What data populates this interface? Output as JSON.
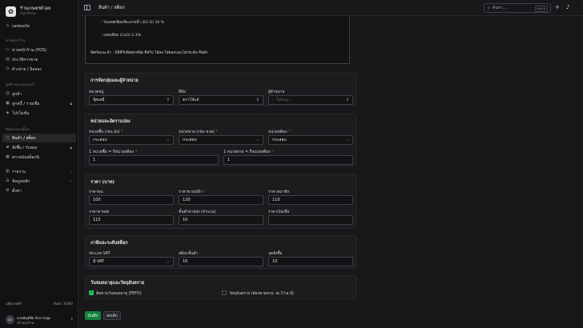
{
  "brand": {
    "name": "ร้านเกษตรตัวอย",
    "sub": "AgriShop"
  },
  "nav": {
    "dashboard": "แดชบอร์ด",
    "sec_sales": "ขายหน้าร้าน",
    "pos": "ขายหน้าร้าน (POS)",
    "history": "ประวัติการขาย",
    "ar": "ค้างจ่าย / บิลจอง",
    "sec_customers": "ลูกค้าและแมมเบอร์",
    "customers": "ลูกค้า",
    "debtors": "ลูกหนี้ / รายเชื่อ",
    "promo": "โปรโมชั่น",
    "sec_stock": "สินค้าและสต็อก",
    "products": "สินค้า / สต็อก",
    "purchase": "สั่งซื้อ / รับของ",
    "count": "ตรวจนับสต็อกนิ",
    "reports": "รายงาน",
    "data": "ข้อมูลหลัก",
    "settings": "ตั้งค่า"
  },
  "sidebar_footer": {
    "plan": "แพ็กเกจฟรี",
    "usage": "สินค้า 3/300",
    "user_initials": "นร",
    "user_name": "นายนันท์ชัย รักการปลูก",
    "user_role": "เจ้าของร้าน"
  },
  "topbar": {
    "breadcrumb": "สินค้า / สต็อก",
    "search_placeholder": "ค้นหา...",
    "shortcut": "Ctrl K"
  },
  "desc": {
    "line1": ": โพแทสเซียมที่ละลายน้ำ (K2 O) 16 %",
    "line2": ": แคลเซียม (CaO) 2.3%",
    "line3": "พิศกัดแนะนำ     : มีสีที่รับพิษทุกชนิด พืชใบ ไม้ผล ไม้ดอกและไม้ประดับ พืชผัก"
  },
  "grouping": {
    "title": "การจัดกลุ่มและผู้จำหน่าย",
    "category_label": "หมวดหมู่",
    "category_value": "ปุ๋ยเคมี",
    "brand_label": "ยี่ห้อ",
    "brand_value": "ตราไจ๋แจ๋",
    "supplier_label": "ผู้จำหน่าย",
    "supplier_value": "-- ไม่ระบุ --"
  },
  "units": {
    "title": "หน่วยและอัตราแปลง",
    "buy_label": "หน่วยซื้อ (เช่น ลัง)",
    "buy_value": "กระสอบ",
    "sell_label": "หน่วยขาย (เช่น ขวด)",
    "sell_value": "กระสอบ",
    "stock_label": "หน่วยสต็อก",
    "stock_value": "กระสอบ",
    "conv_buy_label": "1 หน่วยซื้อ = กี่หน่วยสต็อก",
    "conv_buy_value": "1",
    "conv_sell_label": "1 หน่วยขาย = กี่หน่วยสต็อก",
    "conv_sell_value": "1"
  },
  "pricing": {
    "title": "ราคา (บาท)",
    "cost_label": "ราคาทุน",
    "cost_value": "100",
    "retail_label": "ราคาขายปลีก",
    "retail_value": "120",
    "member_label": "ราคาสมาชิก",
    "member_value": "110",
    "wholesale_label": "ราคาขายส่ง",
    "wholesale_value": "115",
    "min_wholesale_label": "ขั้นต่ำขายส่ง (จำนวน)",
    "min_wholesale_value": "10",
    "credit_label": "ราคาเงินเชื่อ",
    "credit_value": ""
  },
  "tax": {
    "title": "ภาษีและระดับสต็อก",
    "vat_label": "ประเภท VAT",
    "vat_value": "มี VAT",
    "min_label": "สต็อกขั้นต่ำ",
    "min_value": "10",
    "reorder_label": "จุดสั่งซื้อ",
    "reorder_value": "10"
  },
  "expiry": {
    "title": "วันหมดอายุและวัตถุอันตราย",
    "fefo_label": "ติดตามวันหมดอายุ (FEFO)",
    "hazard_label": "วัตถุอันตราย (ต้องขายตาม วอ.7/วอ.9)"
  },
  "actions": {
    "save": "บันทึก",
    "cancel": "ยกเลิก"
  }
}
